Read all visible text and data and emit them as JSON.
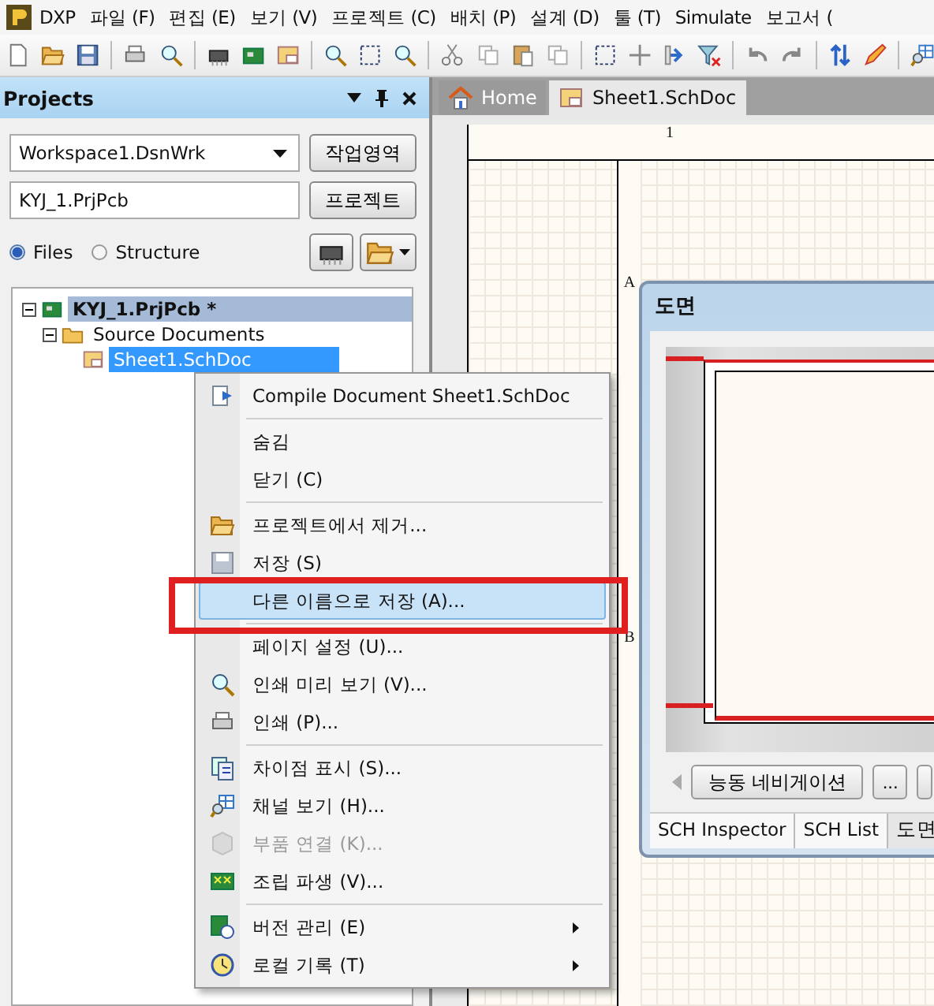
{
  "menu_bar": {
    "items": [
      "DXP",
      "파일 (F)",
      "편집 (E)",
      "보기 (V)",
      "프로젝트 (C)",
      "배치 (P)",
      "설계 (D)",
      "툴 (T)",
      "Simulate",
      "보고서 ("
    ]
  },
  "projects_panel": {
    "title": "Projects",
    "workspace": {
      "value": "Workspace1.DsnWrk",
      "button": "작업영역"
    },
    "project": {
      "value": "KYJ_1.PrjPcb",
      "button": "프로젝트"
    },
    "view_options": [
      {
        "label": "Files",
        "selected": true
      },
      {
        "label": "Structure",
        "selected": false
      }
    ],
    "tree": [
      {
        "label": "KYJ_1.PrjPcb *",
        "kind": "project",
        "selected": true,
        "expanded": true,
        "children": [
          {
            "label": "Source Documents",
            "kind": "folder",
            "selected": false,
            "expanded": true,
            "children": [
              {
                "label": "Sheet1.SchDoc",
                "kind": "document",
                "selected": true
              }
            ]
          }
        ]
      }
    ]
  },
  "document_tabs": [
    {
      "label": "Home",
      "selected": false
    },
    {
      "label": "Sheet1.SchDoc",
      "selected": true
    }
  ],
  "sheet": {
    "column_marks": [
      "1"
    ],
    "row_marks": [
      "A",
      "B"
    ]
  },
  "context_menu": [
    {
      "kind": "item",
      "label": "Compile Document Sheet1.SchDoc",
      "disabled": false,
      "selected": false,
      "submenu": false
    },
    {
      "kind": "separator"
    },
    {
      "kind": "item",
      "label": "숨김",
      "disabled": false,
      "selected": false,
      "submenu": false
    },
    {
      "kind": "item",
      "label": "닫기 (C)",
      "disabled": false,
      "selected": false,
      "submenu": false
    },
    {
      "kind": "separator"
    },
    {
      "kind": "item",
      "label": "프로젝트에서 제거...",
      "disabled": false,
      "selected": false,
      "submenu": false
    },
    {
      "kind": "item",
      "label": "저장 (S)",
      "disabled": false,
      "selected": false,
      "submenu": false
    },
    {
      "kind": "item",
      "label": "다른 이름으로 저장 (A)...",
      "disabled": false,
      "selected": true,
      "submenu": false
    },
    {
      "kind": "separator"
    },
    {
      "kind": "item",
      "label": "페이지 설정 (U)...",
      "disabled": false,
      "selected": false,
      "submenu": false
    },
    {
      "kind": "item",
      "label": "인쇄 미리 보기 (V)...",
      "disabled": false,
      "selected": false,
      "submenu": false
    },
    {
      "kind": "item",
      "label": "인쇄 (P)...",
      "disabled": false,
      "selected": false,
      "submenu": false
    },
    {
      "kind": "separator"
    },
    {
      "kind": "item",
      "label": "차이점 표시 (S)...",
      "disabled": false,
      "selected": false,
      "submenu": false
    },
    {
      "kind": "item",
      "label": "채널 보기 (H)...",
      "disabled": false,
      "selected": false,
      "submenu": false
    },
    {
      "kind": "item",
      "label": "부품 연결 (K)...",
      "disabled": true,
      "selected": false,
      "submenu": false
    },
    {
      "kind": "item",
      "label": "조립 파생 (V)...",
      "disabled": false,
      "selected": false,
      "submenu": false
    },
    {
      "kind": "separator"
    },
    {
      "kind": "item",
      "label": "버전 관리 (E)",
      "disabled": false,
      "selected": false,
      "submenu": true
    },
    {
      "kind": "item",
      "label": "로컬 기록 (T)",
      "disabled": false,
      "selected": false,
      "submenu": true
    }
  ],
  "sheet_panel": {
    "title": "도면",
    "nav_button": "능동 네비게이션",
    "more_button": "...",
    "tabs": [
      {
        "label": "SCH Inspector",
        "selected": false
      },
      {
        "label": "SCH List",
        "selected": false
      },
      {
        "label": "도면",
        "selected": true
      }
    ]
  }
}
